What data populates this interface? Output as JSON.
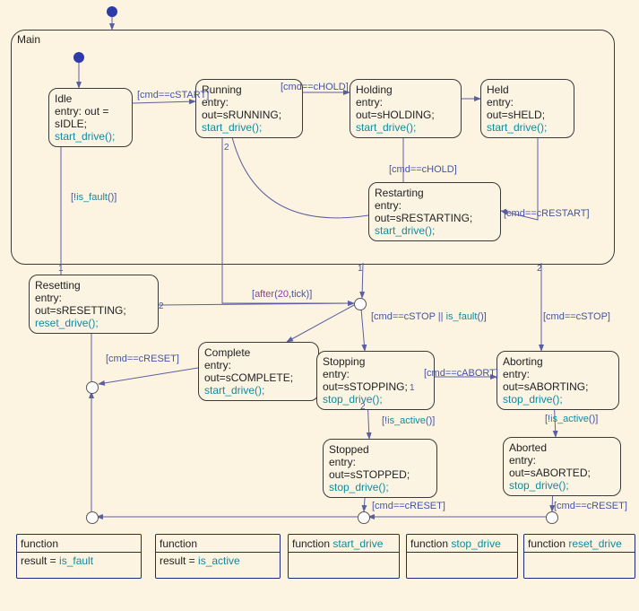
{
  "main": {
    "title": "Main"
  },
  "states": {
    "idle": {
      "name": "Idle",
      "entry": "entry: out = sIDLE;",
      "action": "start_drive();"
    },
    "running": {
      "name": "Running",
      "entry": "entry: out=sRUNNING;",
      "action": "start_drive();"
    },
    "holding": {
      "name": "Holding",
      "entry": "entry: out=sHOLDING;",
      "action": "start_drive();"
    },
    "held": {
      "name": "Held",
      "entry": "entry: out=sHELD;",
      "action": "start_drive();"
    },
    "restarting": {
      "name": "Restarting",
      "entry": "entry: out=sRESTARTING;",
      "action": "start_drive();"
    },
    "resetting": {
      "name": "Resetting",
      "entry": "entry: out=sRESETTING;",
      "action": "reset_drive();"
    },
    "complete": {
      "name": "Complete",
      "entry": "entry: out=sCOMPLETE;",
      "action": "start_drive();"
    },
    "stopping": {
      "name": "Stopping",
      "entry": "entry: out=sSTOPPING;",
      "action": "stop_drive();"
    },
    "aborting": {
      "name": "Aborting",
      "entry": "entry: out=sABORTING;",
      "action": "stop_drive();"
    },
    "stopped": {
      "name": "Stopped",
      "entry": "entry: out=sSTOPPED;",
      "action": "stop_drive();"
    },
    "aborted": {
      "name": "Aborted",
      "entry": "entry: out=sABORTED;",
      "action": "stop_drive();"
    }
  },
  "transitions": {
    "idle_running": "[cmd==cSTART]",
    "running_holding": "[cmd==cHOLD]",
    "restarting_holding": "[cmd==cHOLD]",
    "held_restarting": "[cmd==cRESTART]",
    "resetting_idle": "[!is_fault()]",
    "running_after": "[after(20,tick)]",
    "j1_stopping": "[cmd==cSTOP || is_fault()]",
    "j1_aborting": "[cmd==cSTOP]",
    "stopping_aborting": "[cmd==cABORT]",
    "stopping_stopped": "[!is_active()]",
    "aborting_aborted": "[!is_active()]",
    "stopped_reset": "[cmd==cRESET]",
    "aborted_reset": "[cmd==cRESET]",
    "complete_reset": "[cmd==cRESET]"
  },
  "ports": {
    "p1": "1",
    "p2": "2"
  },
  "functions": {
    "isfault": {
      "title": "function",
      "body_pre": "result = ",
      "body_call": "is_fault"
    },
    "isactive": {
      "title": "function",
      "body_pre": "result = ",
      "body_call": "is_active"
    },
    "startdrive": {
      "title_pre": "function  ",
      "title_call": "start_drive"
    },
    "stopdrive": {
      "title_pre": "function  ",
      "title_call": "stop_drive"
    },
    "resetdrive": {
      "title_pre": "function  ",
      "title_call": "reset_drive"
    }
  }
}
